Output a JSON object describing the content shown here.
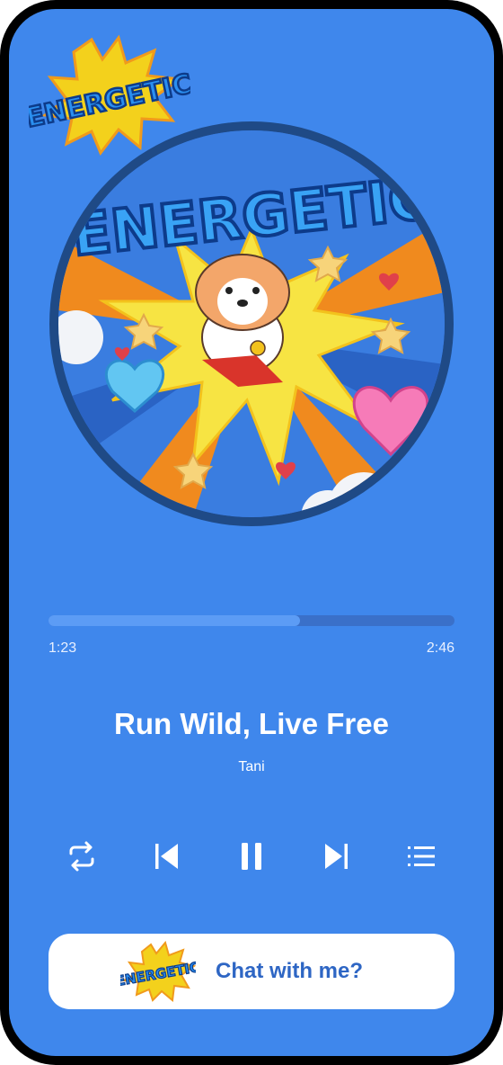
{
  "app": {
    "logo_text": "ENERGETIC"
  },
  "player": {
    "progress_fraction": 0.62,
    "time_elapsed": "1:23",
    "time_total": "2:46",
    "track_title": "Run Wild, Live Free",
    "artist": "Tani"
  },
  "controls": [
    {
      "name": "repeat-icon"
    },
    {
      "name": "skip-previous-icon"
    },
    {
      "name": "pause-icon"
    },
    {
      "name": "skip-next-icon"
    },
    {
      "name": "playlist-icon"
    }
  ],
  "chat": {
    "label": "Chat with me?",
    "logo_text": "ENERGETIC"
  },
  "colors": {
    "background": "#3f87ec",
    "track": "#3a70c9",
    "fill": "#5c9cf5",
    "chat_text": "#2e66c4"
  }
}
